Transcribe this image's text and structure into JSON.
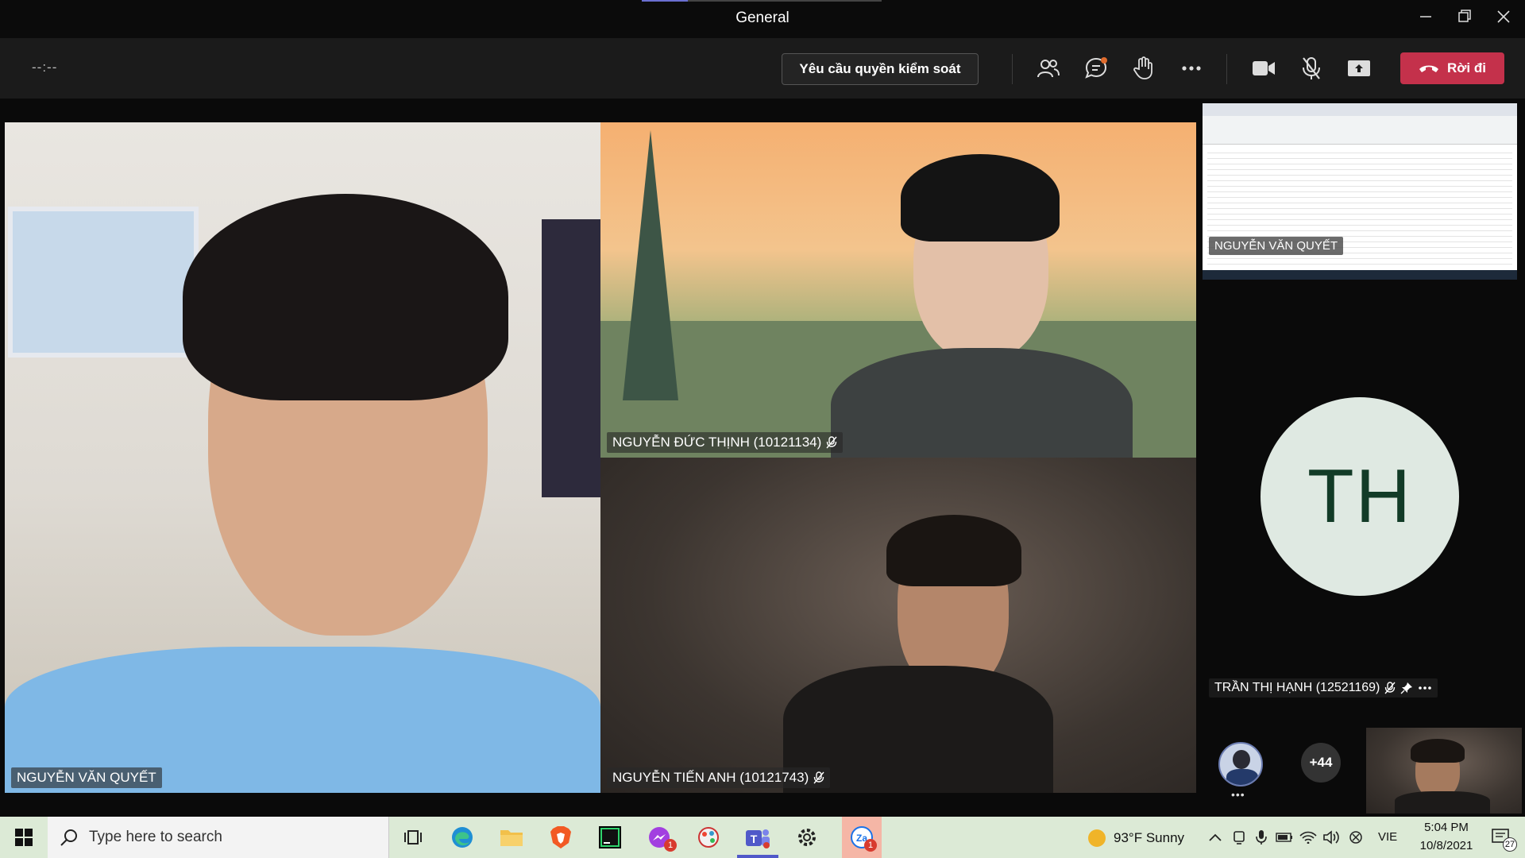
{
  "window": {
    "title": "General"
  },
  "toolbar": {
    "timer": "--:--",
    "request_control_label": "Yêu cầu quyền kiểm soát",
    "leave_label": "Rời đi"
  },
  "participants": {
    "main_left": {
      "name": "NGUYỄN VĂN QUYẾT"
    },
    "top_right": {
      "name": "NGUYỄN ĐỨC THỊNH (10121134)"
    },
    "bottom_right": {
      "name": "NGUYỄN TIẾN ANH (10121743)"
    },
    "share": {
      "name": "NGUYỄN VĂN QUYẾT"
    },
    "avatar_tile": {
      "initials": "TH",
      "name": "TRẦN THỊ HẠNH (12521169)"
    },
    "overflow_count": "+44",
    "small_avatar_more": "•••"
  },
  "taskbar": {
    "search_placeholder": "Type here to search",
    "weather": "93°F  Sunny",
    "language": "VIE",
    "time": "5:04 PM",
    "date": "10/8/2021",
    "notifications": "27",
    "app_badges": {
      "messenger": "1",
      "zalo": "1"
    }
  },
  "colors": {
    "leave": "#c4314b",
    "taskbar": "#dcead6",
    "avatar_bg": "#dfe9e2",
    "avatar_text": "#123b27"
  }
}
